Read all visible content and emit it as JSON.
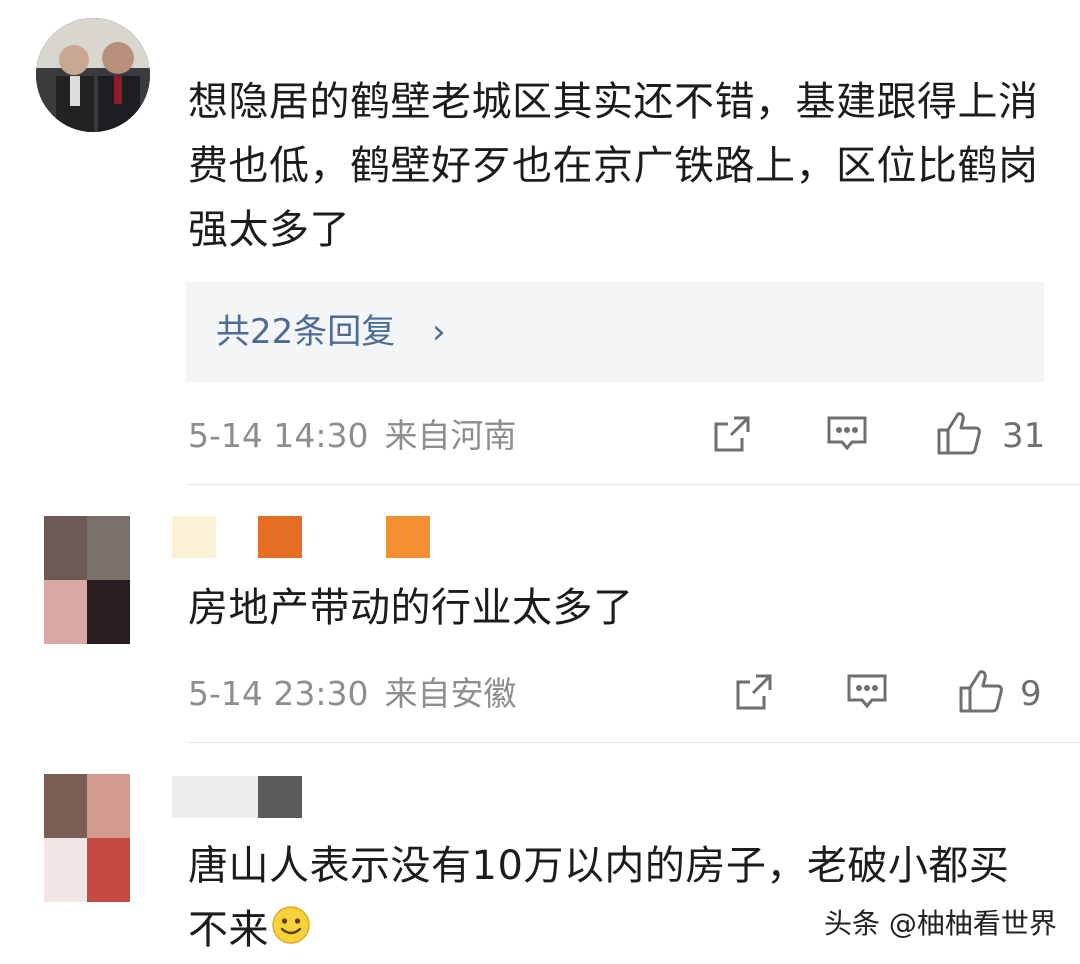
{
  "comments": [
    {
      "text": "想隐居的鹤壁老城区其实还不错，基建跟得上消费也低，鹤壁好歹也在京广铁路上，区位比鹤岗强太多了",
      "reply_label": "共22条回复",
      "reply_chevron": "›",
      "time": "5-14 14:30",
      "location": "来自河南",
      "likes": "31"
    },
    {
      "text": "房地产带动的行业太多了",
      "time": "5-14 23:30",
      "location": "来自安徽",
      "likes": "9"
    },
    {
      "text": "唐山人表示没有10万以内的房子，老破小都买不来"
    }
  ],
  "icons": {
    "share": "share-icon",
    "comment": "comment-icon",
    "like": "thumbs-up-icon",
    "emoji": "smiley-emoji-icon"
  },
  "watermark": "头条 @柚柚看世界",
  "colors": {
    "reply_link": "#4f6b95",
    "meta": "#8e8e8e",
    "reply_bg": "#f4f5f7"
  }
}
